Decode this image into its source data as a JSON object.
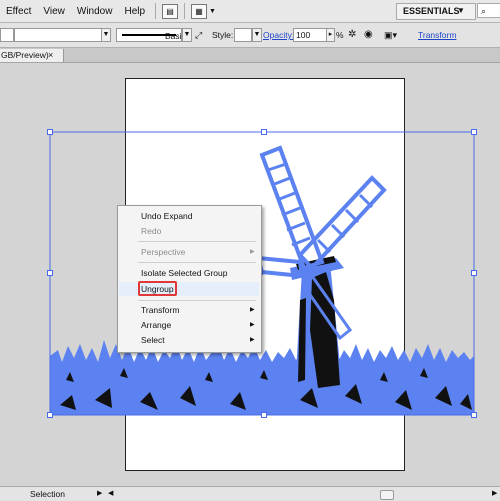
{
  "menubar": {
    "items": [
      "Effect",
      "View",
      "Window",
      "Help"
    ],
    "workspace": "ESSENTIALS",
    "search_icon": "search-icon"
  },
  "control": {
    "stroke_profile": "Basic",
    "style_label": "Style:",
    "opacity_link": "Opacity:",
    "opacity_value": "100",
    "percent": "%",
    "transform_link": "Transform"
  },
  "tab": {
    "doc_title": "GB/Preview)",
    "close": "×"
  },
  "colors": {
    "selection": "#4a6ae8",
    "art_blue": "#5b82f0",
    "highlight_box": "#e03838"
  },
  "context_menu": {
    "items": [
      {
        "label": "Undo Expand",
        "enabled": true,
        "submenu": false
      },
      {
        "label": "Redo",
        "enabled": false,
        "submenu": false
      },
      {
        "label": "Perspective",
        "enabled": false,
        "submenu": true
      },
      {
        "label": "Isolate Selected Group",
        "enabled": true,
        "submenu": false
      },
      {
        "label": "Ungroup",
        "enabled": true,
        "submenu": false,
        "highlighted": true
      },
      {
        "label": "Transform",
        "enabled": true,
        "submenu": true
      },
      {
        "label": "Arrange",
        "enabled": true,
        "submenu": true
      },
      {
        "label": "Select",
        "enabled": true,
        "submenu": true
      }
    ]
  },
  "status": {
    "tool": "Selection"
  }
}
